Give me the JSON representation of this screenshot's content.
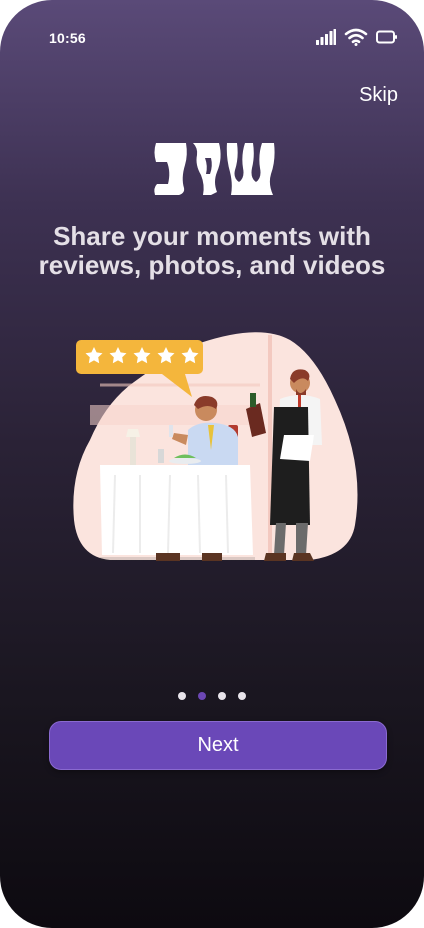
{
  "status_bar": {
    "time": "10:56",
    "icons": [
      "signal-icon",
      "wifi-icon",
      "battery-icon"
    ]
  },
  "header": {
    "skip_label": "Skip"
  },
  "logo": {
    "icon": "brand-logo"
  },
  "onboarding": {
    "headline_line1": "Share your moments with",
    "headline_line2": "reviews, photos, and videos",
    "illustration": "restaurant-review-illustration",
    "page_count": 4,
    "current_page": 2
  },
  "actions": {
    "next_label": "Next"
  },
  "colors": {
    "accent": "#6a48b8",
    "active_dot": "#6c47b4",
    "star_bubble": "#f4b63c"
  }
}
